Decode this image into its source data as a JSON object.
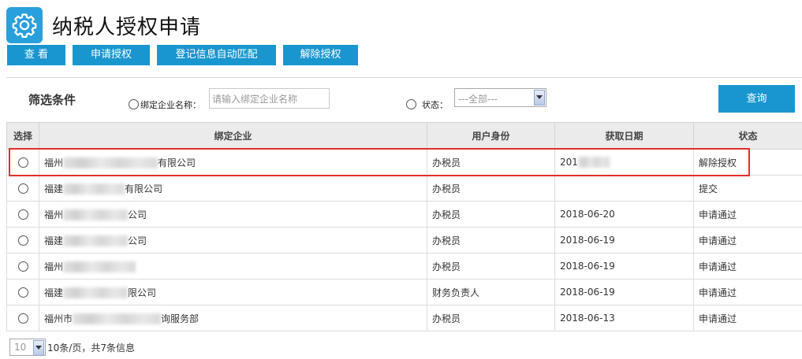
{
  "header": {
    "title": "纳税人授权申请",
    "icon": "gear-icon",
    "icon_color": "#29a0dc"
  },
  "toolbar": {
    "view": "查 看",
    "apply": "申请授权",
    "auto_match": "登记信息自动匹配",
    "revoke": "解除授权"
  },
  "filter": {
    "title": "筛选条件",
    "company_label": "绑定企业名称：",
    "company_placeholder": "请输入绑定企业名称",
    "status_label": "状态：",
    "status_selected": "---全部---",
    "search_button": "查询"
  },
  "table": {
    "columns": [
      "选择",
      "绑定企业",
      "用户身份",
      "获取日期",
      "状态"
    ],
    "rows": [
      {
        "company_prefix": "福州",
        "company_suffix": "有限公司",
        "role": "办税员",
        "date": "201",
        "status": "解除授权"
      },
      {
        "company_prefix": "福建",
        "company_suffix": "有限公司",
        "role": "办税员",
        "date": "",
        "status": "提交"
      },
      {
        "company_prefix": "福州",
        "company_suffix": "公司",
        "role": "办税员",
        "date": "2018-06-20",
        "status": "申请通过"
      },
      {
        "company_prefix": "福建",
        "company_suffix": "公司",
        "role": "办税员",
        "date": "2018-06-19",
        "status": "申请通过"
      },
      {
        "company_prefix": "福州",
        "company_suffix": "",
        "role": "办税员",
        "date": "2018-06-19",
        "status": "申请通过"
      },
      {
        "company_prefix": "福建",
        "company_suffix": "限公司",
        "role": "财务负责人",
        "date": "2018-06-19",
        "status": "申请通过"
      },
      {
        "company_prefix": "福州市",
        "company_suffix": "询服务部",
        "role": "办税员",
        "date": "2018-06-13",
        "status": "申请通过"
      }
    ]
  },
  "pager": {
    "page_size": "10",
    "info": "10条/页，共7条信息"
  },
  "colors": {
    "accent": "#1a96cf",
    "highlight": "#e0302e"
  }
}
